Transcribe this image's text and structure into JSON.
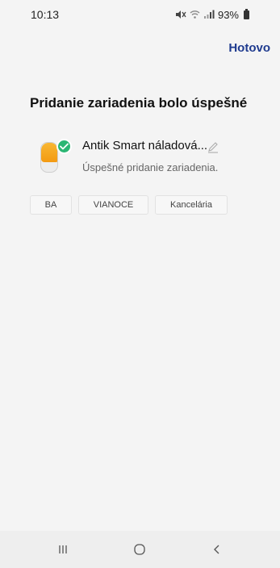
{
  "status_bar": {
    "time": "10:13",
    "battery": "93%",
    "icons": [
      "mute-icon",
      "wifi-icon",
      "signal-icon",
      "battery-icon"
    ]
  },
  "header": {
    "done_label": "Hotovo"
  },
  "main": {
    "title": "Pridanie zariadenia bolo úspešné",
    "device": {
      "name": "Antik Smart náladová...",
      "status": "Úspešné pridanie zariadenia.",
      "icon": "night-lamp-icon",
      "badge_icon": "check-icon"
    },
    "rooms": [
      {
        "label": "BA"
      },
      {
        "label": "VIANOCE"
      },
      {
        "label": "Kancelária"
      }
    ]
  },
  "navbar": {
    "icons": [
      "recent-apps-icon",
      "home-icon",
      "back-icon"
    ]
  },
  "colors": {
    "accent": "#1f3b8f",
    "success": "#2bb673",
    "lamp": "#f39a12",
    "background": "#f4f4f4"
  }
}
